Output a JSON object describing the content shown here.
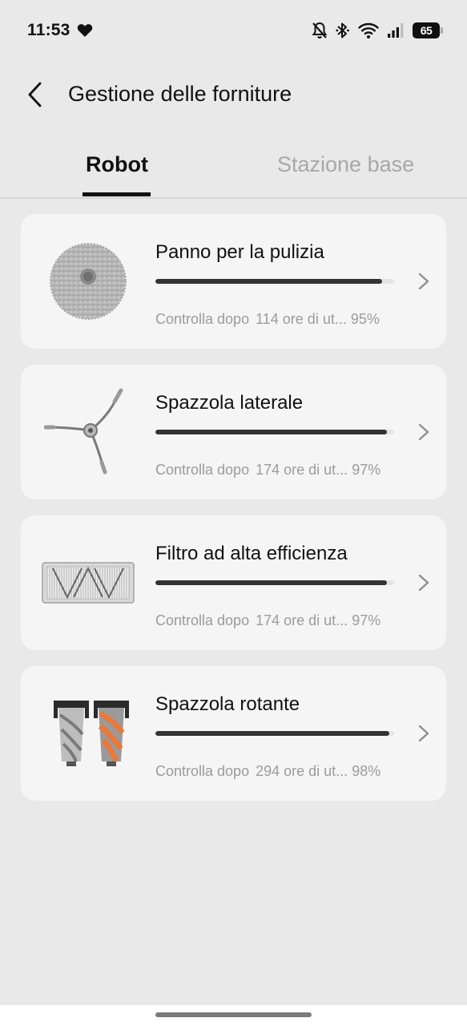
{
  "status_bar": {
    "time": "11:53",
    "battery": "65",
    "icons": [
      "heart-icon",
      "bell-off-icon",
      "bluetooth-icon",
      "wifi-icon",
      "signal-icon",
      "battery-icon"
    ]
  },
  "header": {
    "title": "Gestione delle forniture",
    "back_icon": "chevron-left-icon"
  },
  "tabs": [
    {
      "label": "Robot",
      "active": true
    },
    {
      "label": "Stazione base",
      "active": false
    }
  ],
  "colors": {
    "background": "#e9e9e9",
    "card": "#f5f5f5",
    "progress_fill": "#333333",
    "progress_track": "#e4e4e4",
    "muted_text": "#9b9b9b",
    "inactive_tab": "#a8a8a8",
    "orange_brush": "#e8793a"
  },
  "items": [
    {
      "title": "Panno per la pulizia",
      "image": "mop-pad-image",
      "sub_label": "Controlla dopo",
      "sub_detail": "114 ore di ut...",
      "percent_label": "95%",
      "progress": 0.95
    },
    {
      "title": "Spazzola laterale",
      "image": "side-brush-image",
      "sub_label": "Controlla dopo",
      "sub_detail": "174 ore di ut...",
      "percent_label": "97%",
      "progress": 0.97
    },
    {
      "title": "Filtro ad alta efficienza",
      "image": "hepa-filter-image",
      "sub_label": "Controlla dopo",
      "sub_detail": "174 ore di ut...",
      "percent_label": "97%",
      "progress": 0.97
    },
    {
      "title": "Spazzola rotante",
      "image": "roller-brush-image",
      "sub_label": "Controlla dopo",
      "sub_detail": "294 ore di ut...",
      "percent_label": "98%",
      "progress": 0.98
    }
  ]
}
